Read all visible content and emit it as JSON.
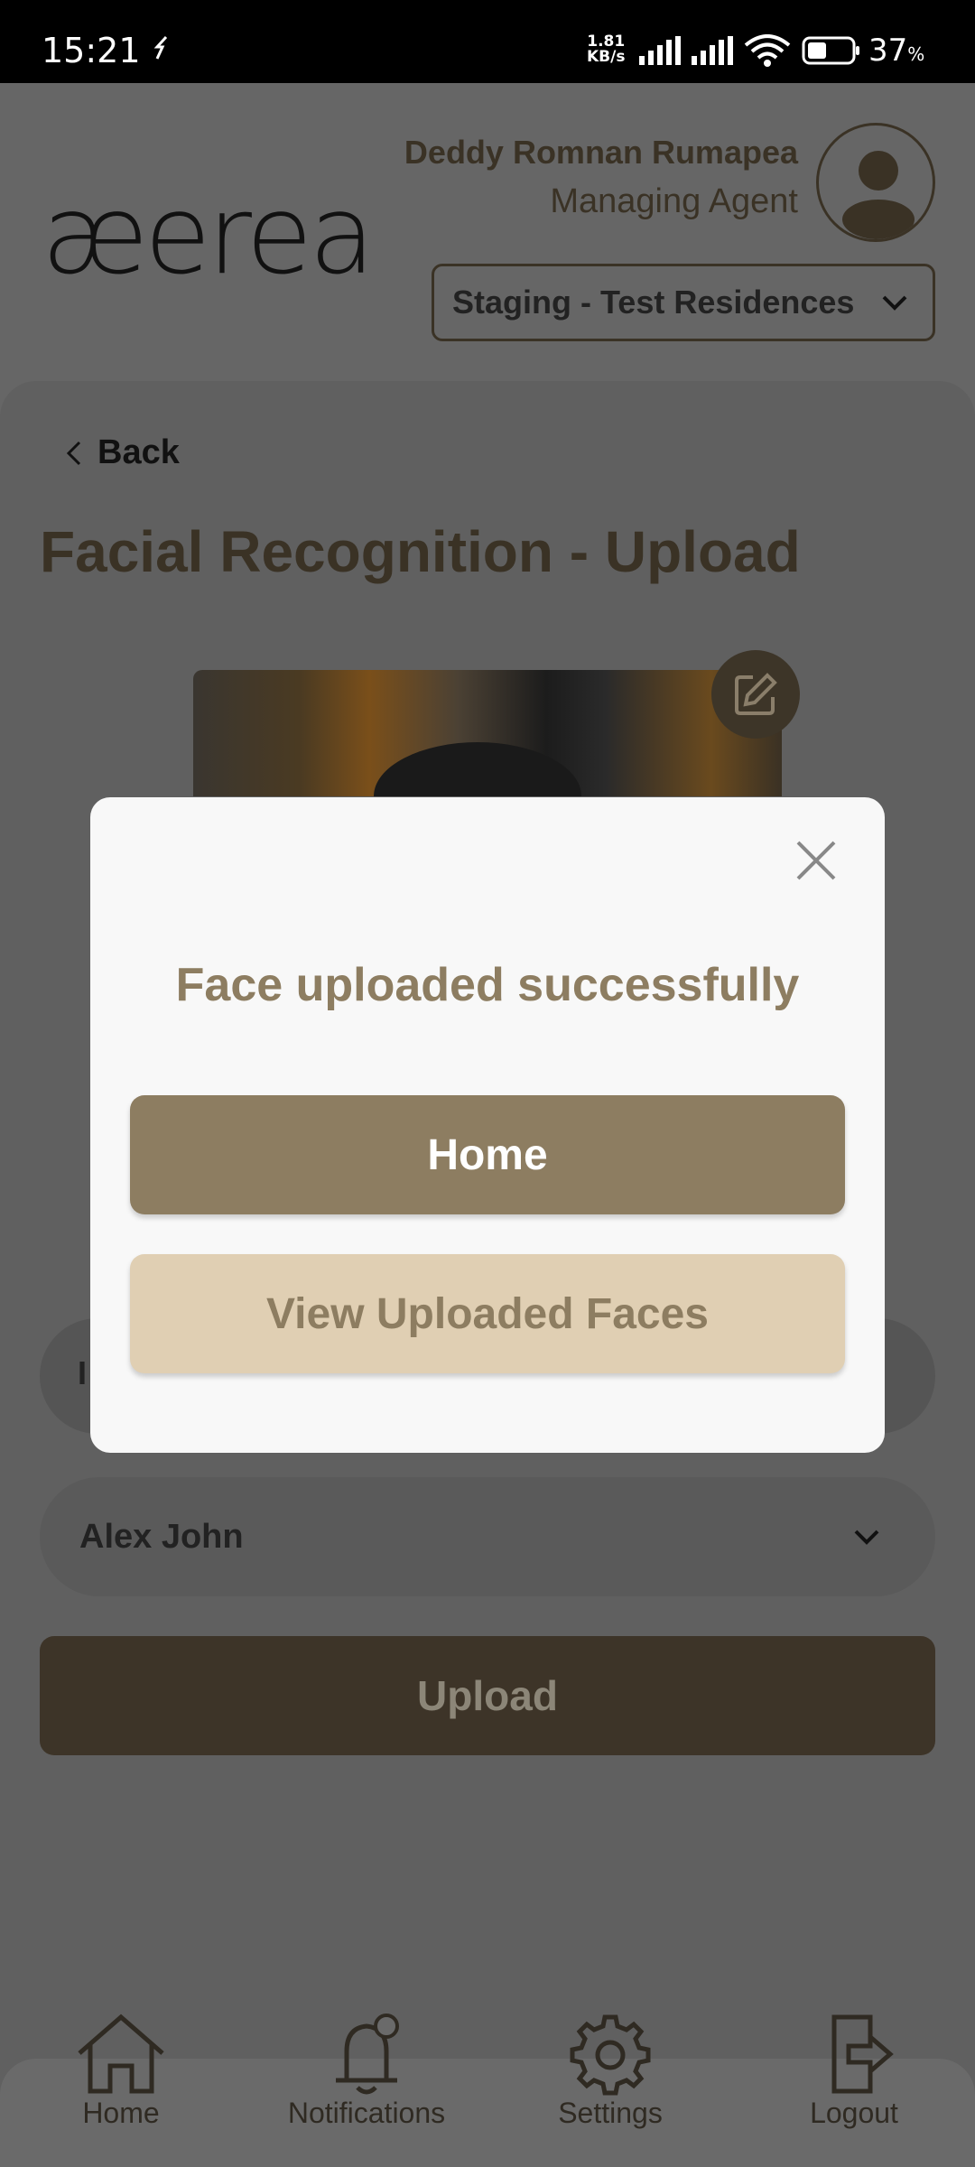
{
  "status_bar": {
    "time": "15:21",
    "net_speed_value": "1.81",
    "net_speed_unit": "KB/s",
    "battery_percent": "37",
    "battery_unit": "%"
  },
  "header": {
    "logo": "æerea",
    "user_name": "Deddy Romnan Rumapea",
    "user_role": "Managing Agent",
    "property": "Staging - Test Residences"
  },
  "page": {
    "back_label": "Back",
    "title": "Facial Recognition - Upload",
    "hidden_field_initial": "I",
    "selected_name": "Alex John",
    "upload_label": "Upload"
  },
  "modal": {
    "message": "Face uploaded successfully",
    "home_label": "Home",
    "view_label": "View Uploaded Faces"
  },
  "bottom_nav": {
    "home": "Home",
    "notifications": "Notifications",
    "settings": "Settings",
    "logout": "Logout"
  },
  "colors": {
    "accent": "#8d7d61",
    "accent_light": "#e0cfb3",
    "overlay": "#666666"
  },
  "icons": [
    "sync-icon",
    "signal-icon",
    "wifi-icon",
    "battery-icon",
    "avatar-icon",
    "chevron-down-icon",
    "back-chevron-icon",
    "edit-icon",
    "close-icon",
    "home-icon",
    "bell-icon",
    "gear-icon",
    "logout-icon"
  ]
}
